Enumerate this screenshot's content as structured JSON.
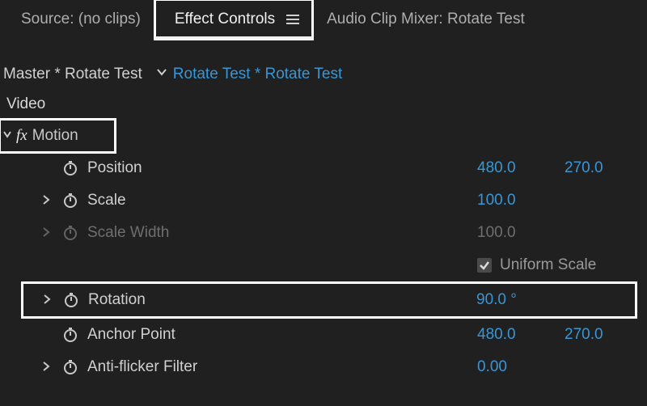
{
  "tabs": {
    "source": "Source: (no clips)",
    "effect_controls": "Effect Controls",
    "audio_mixer": "Audio Clip Mixer: Rotate Test"
  },
  "clip": {
    "master": "Master * Rotate Test",
    "current": "Rotate Test * Rotate Test"
  },
  "video_label": "Video",
  "motion_label": "Motion",
  "props": {
    "position": {
      "label": "Position",
      "x": "480.0",
      "y": "270.0"
    },
    "scale": {
      "label": "Scale",
      "value": "100.0"
    },
    "scale_width": {
      "label": "Scale Width",
      "value": "100.0"
    },
    "uniform_scale": {
      "label": "Uniform Scale",
      "checked": true
    },
    "rotation": {
      "label": "Rotation",
      "value": "90.0 °"
    },
    "anchor": {
      "label": "Anchor Point",
      "x": "480.0",
      "y": "270.0"
    },
    "antiflicker": {
      "label": "Anti-flicker Filter",
      "value": "0.00"
    }
  }
}
